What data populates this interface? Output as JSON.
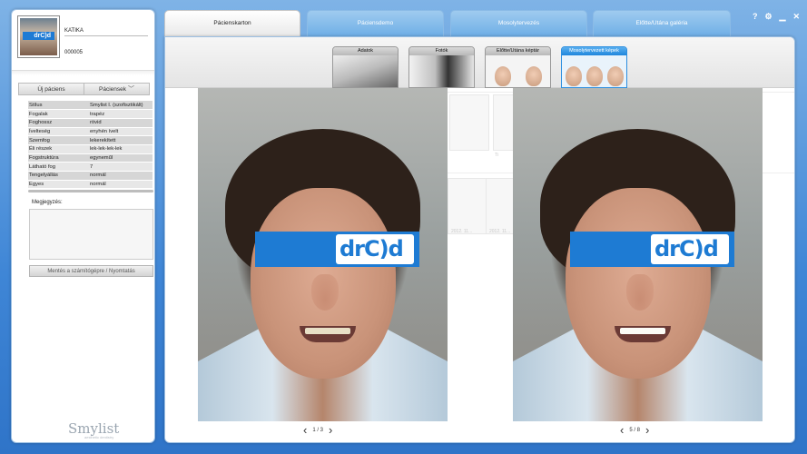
{
  "patient": {
    "name": "KATIKA",
    "id": "000005",
    "avatar_logo_text": "drC)d"
  },
  "left": {
    "new_patient_label": "Új páciens",
    "patients_label": "Páciensek",
    "attributes": [
      {
        "key": "Stílus",
        "value": "Smylist I. (szofisztikált)"
      },
      {
        "key": "Fogalak",
        "value": "trapéz"
      },
      {
        "key": "Foghossz",
        "value": "rövid"
      },
      {
        "key": "Ívelteség",
        "value": "enyhén ívelt"
      },
      {
        "key": "Szemfog",
        "value": "lekerekített"
      },
      {
        "key": "Éli részek",
        "value": "lek-lek-lek-lek"
      },
      {
        "key": "Fogstruktúra",
        "value": "egyneműl"
      },
      {
        "key": "Látható fog",
        "value": "7"
      },
      {
        "key": "Tengelyállás",
        "value": "normál"
      },
      {
        "key": "Egyes",
        "value": "normál"
      }
    ],
    "notes_label": "Megjegyzés:",
    "save_print_label": "Mentés a számítógépre / Nyomtatás",
    "logo_text": "Smylist",
    "logo_sub": "aesthetic dentistry"
  },
  "tabs": [
    {
      "label": "Pácienskarton"
    },
    {
      "label": "Páciensdemo"
    },
    {
      "label": "Mosolytervezés"
    },
    {
      "label": "Előtte/Utána galéria"
    }
  ],
  "window_controls": {
    "help": "?",
    "settings": "⚙",
    "minimize": "▁",
    "close": "✕"
  },
  "subtabs": [
    {
      "label": "Adatok"
    },
    {
      "label": "Fotók"
    },
    {
      "label": "Előtte/Utána képtár"
    },
    {
      "label": "Mosolytervezett képek"
    }
  ],
  "ghost": {
    "date1": "2012. 11...",
    "date2": "2012. 11...",
    "letter": "Ti"
  },
  "viewer_left": {
    "page": "1 / 3",
    "band_logo": "drC)d"
  },
  "viewer_right": {
    "page": "5 / 8",
    "band_logo": "drC)d"
  },
  "colors": {
    "accent": "#1e7bd3",
    "background": "#3f86d6",
    "tab_active": "#ffffff"
  }
}
